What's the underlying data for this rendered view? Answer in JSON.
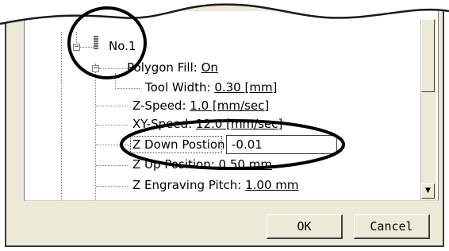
{
  "tree": {
    "root_label": "No.1",
    "items": [
      {
        "label": "Polygon Fill: ",
        "value": "On"
      },
      {
        "label": "Tool Width: ",
        "value": "0.30 [mm]"
      },
      {
        "label": "Z-Speed: ",
        "value": "1.0 [mm/sec]"
      },
      {
        "label": "XY-Speed: ",
        "value": "12.0 [mm/sec]"
      },
      {
        "label": "Z Down Postion:",
        "value": ""
      },
      {
        "label": "Z Up Position: ",
        "value": "0.50 mm"
      },
      {
        "label": "Z Engraving Pitch: ",
        "value": "1.00 mm"
      }
    ],
    "edit_value": "-0.01"
  },
  "buttons": {
    "ok_label": "OK",
    "cancel_label": "Cancel"
  },
  "icons": {
    "scroll_down": "scroll-down-arrow-icon",
    "expander": "collapse-minus-icon"
  }
}
